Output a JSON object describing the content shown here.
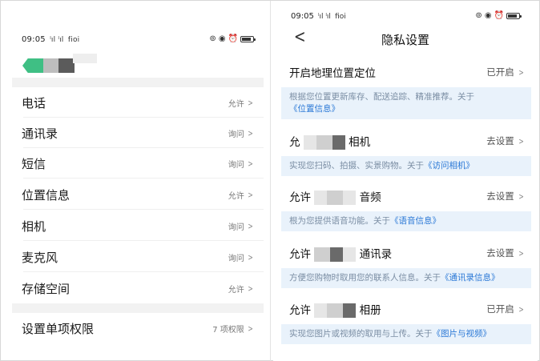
{
  "left": {
    "status": {
      "time": "09:05",
      "signal": "ˡıl ˡıl",
      "network": "fioi"
    },
    "permissions": [
      {
        "label": "电话",
        "value": "允许"
      },
      {
        "label": "通讯录",
        "value": "询问"
      },
      {
        "label": "短信",
        "value": "询问"
      },
      {
        "label": "位置信息",
        "value": "允许"
      },
      {
        "label": "相机",
        "value": "询问"
      },
      {
        "label": "麦克风",
        "value": "询问"
      },
      {
        "label": "存储空间",
        "value": "允许"
      }
    ],
    "single": {
      "label": "设置单项权限",
      "value": "7 项权限"
    }
  },
  "right": {
    "status": {
      "time": "09:05",
      "signal": "ˡıl ˡıl",
      "network": "fioi"
    },
    "title": "隐私设置",
    "settings": [
      {
        "name": "开启地理位置定位",
        "state": "已开启",
        "desc_text": "根据您位置更新库存、配送追踪、精准推荐。关于",
        "desc_link": "《位置信息》"
      },
      {
        "name_prefix": "允",
        "name": "相机",
        "state": "去设置",
        "desc_text": "实现您扫码、拍摄、实景购物。关于",
        "desc_link": "《访问相机》"
      },
      {
        "name_prefix": "允许",
        "name": "音频",
        "state": "去设置",
        "desc_text": "根为您提供语音功能。关于",
        "desc_link": "《语音信息》"
      },
      {
        "name_prefix": "允许",
        "name": "通讯录",
        "state": "去设置",
        "desc_text": "方便您购物时取用您的联系人信息。关于",
        "desc_link": "《通讯录信息》"
      },
      {
        "name_prefix": "允许",
        "name": "相册",
        "state": "已开启",
        "desc_text": "实现您图片或视频的取用与上传。关于",
        "desc_link": "《图片与视频》"
      }
    ]
  }
}
